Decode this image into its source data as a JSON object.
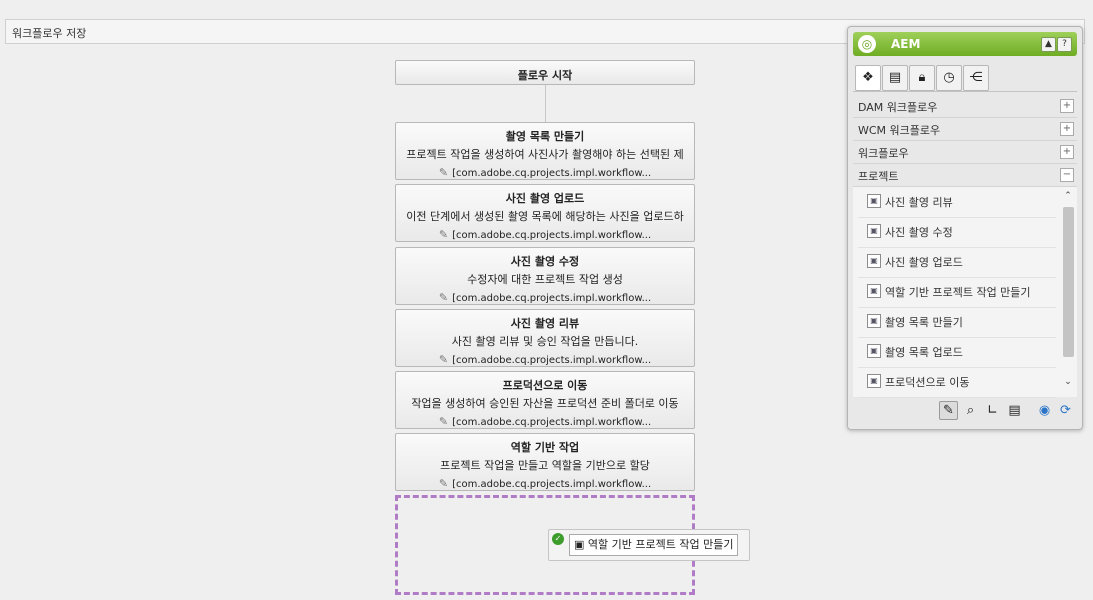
{
  "toolbar": {
    "save_label": "워크플로우 저장"
  },
  "start_step": {
    "title": "플로우 시작"
  },
  "steps": [
    {
      "title": "촬영 목록 만들기",
      "description": "프로젝트 작업을 생성하여 사진사가 촬영해야 하는 선택된 제",
      "impl": "[com.adobe.cq.projects.impl.workflow..."
    },
    {
      "title": "사진 촬영 업로드",
      "description": "이전 단계에서 생성된 촬영 목록에 해당하는 사진을 업로드하",
      "impl": "[com.adobe.cq.projects.impl.workflow..."
    },
    {
      "title": "사진 촬영 수정",
      "description": "수정자에 대한 프로젝트 작업 생성",
      "impl": "[com.adobe.cq.projects.impl.workflow..."
    },
    {
      "title": "사진 촬영 리뷰",
      "description": "사진 촬영 리뷰 및 승인 작업을 만듭니다.",
      "impl": "[com.adobe.cq.projects.impl.workflow..."
    },
    {
      "title": "프로덕션으로 이동",
      "description": "작업을 생성하여 승인된 자산을 프로덕션 준비 폴더로 이동",
      "impl": "[com.adobe.cq.projects.impl.workflow..."
    },
    {
      "title": "역할 기반 작업",
      "description": "프로젝트 작업을 만들고 역할을 기반으로 할당",
      "impl": "[com.adobe.cq.projects.impl.workflow..."
    }
  ],
  "drag_item": {
    "label": "역할 기반 프로젝트 작업 만들기"
  },
  "sidekick": {
    "title": "AEM",
    "header_buttons": [
      "▲",
      "?"
    ],
    "tabs": [
      "components-icon",
      "page-icon",
      "lock-icon",
      "clock-icon",
      "workflow-icon"
    ],
    "groups": [
      {
        "label": "DAM 워크플로우",
        "toggle": "+"
      },
      {
        "label": "WCM 워크플로우",
        "toggle": "+"
      },
      {
        "label": "워크플로우",
        "toggle": "+"
      },
      {
        "label": "프로젝트",
        "toggle": "−"
      }
    ],
    "items": [
      "사진 촬영 리뷰",
      "사진 촬영 수정",
      "사진 촬영 업로드",
      "역할 기반 프로젝트 작업 만들기",
      "촬영 목록 만들기",
      "촬영 목록 업로드",
      "프로덕션으로 이동"
    ],
    "footer_buttons": [
      "edit-pencil-icon",
      "preview-magnifier-icon",
      "design-ruler-icon",
      "properties-page-icon",
      "globe-icon",
      "refresh-icon"
    ]
  },
  "colors": {
    "accent": "#7fba3a",
    "dropzone": "#b07cc6"
  }
}
